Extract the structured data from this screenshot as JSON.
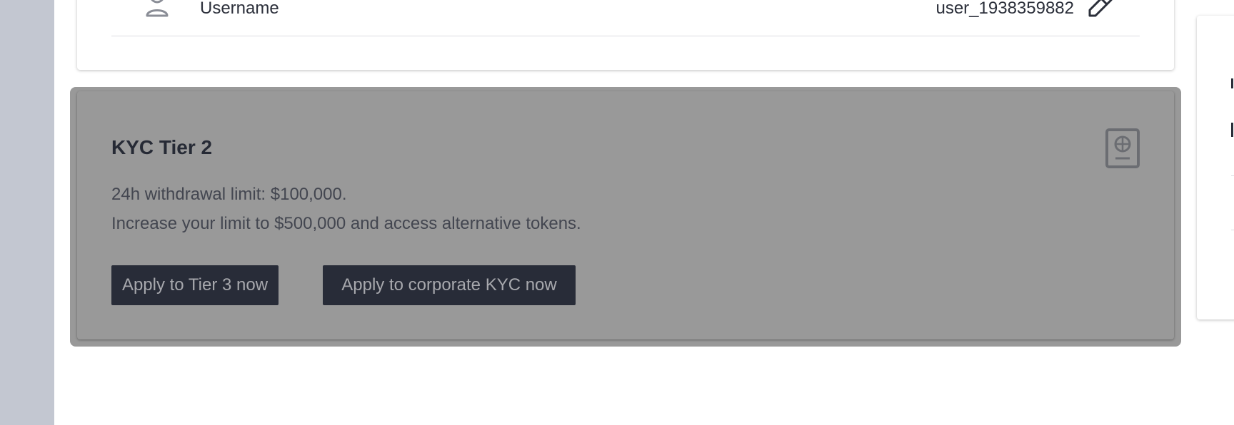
{
  "profile": {
    "row_label": "Username",
    "row_value": "user_1938359882",
    "icons": [
      "user-icon",
      "edit-icon"
    ]
  },
  "kyc": {
    "title": "KYC Tier 2",
    "limit_text": "24h withdrawal limit: $100,000.",
    "increase_text": "Increase your limit to $500,000 and access alternative tokens.",
    "apply_tier3_label": "Apply to Tier 3 now",
    "apply_corporate_label": "Apply to corporate KYC now",
    "icon": "passport-icon"
  },
  "colors": {
    "sidebar": "#c3c7d1",
    "overlay": "#999999",
    "button_bg": "#282c38",
    "button_text": "#a7a8ad",
    "text_dark": "#262a35"
  }
}
